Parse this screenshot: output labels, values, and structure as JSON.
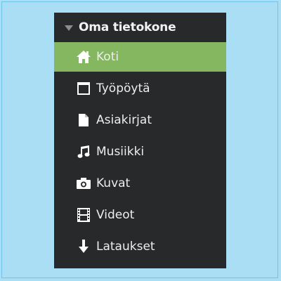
{
  "sidebar": {
    "section_title": "Oma tietokone",
    "section_icon": "triangle-down-icon",
    "items": [
      {
        "label": "Koti",
        "icon": "home-icon",
        "active": true
      },
      {
        "label": "Työpöytä",
        "icon": "desktop-icon",
        "active": false
      },
      {
        "label": "Asiakirjat",
        "icon": "document-icon",
        "active": false
      },
      {
        "label": "Musiikki",
        "icon": "music-icon",
        "active": false
      },
      {
        "label": "Kuvat",
        "icon": "camera-icon",
        "active": false
      },
      {
        "label": "Videot",
        "icon": "film-icon",
        "active": false
      },
      {
        "label": "Lataukset",
        "icon": "download-icon",
        "active": false
      }
    ]
  },
  "colors": {
    "background": "#a9def4",
    "sidebar": "#27292b",
    "active": "#85b760",
    "text": "#ededed"
  }
}
